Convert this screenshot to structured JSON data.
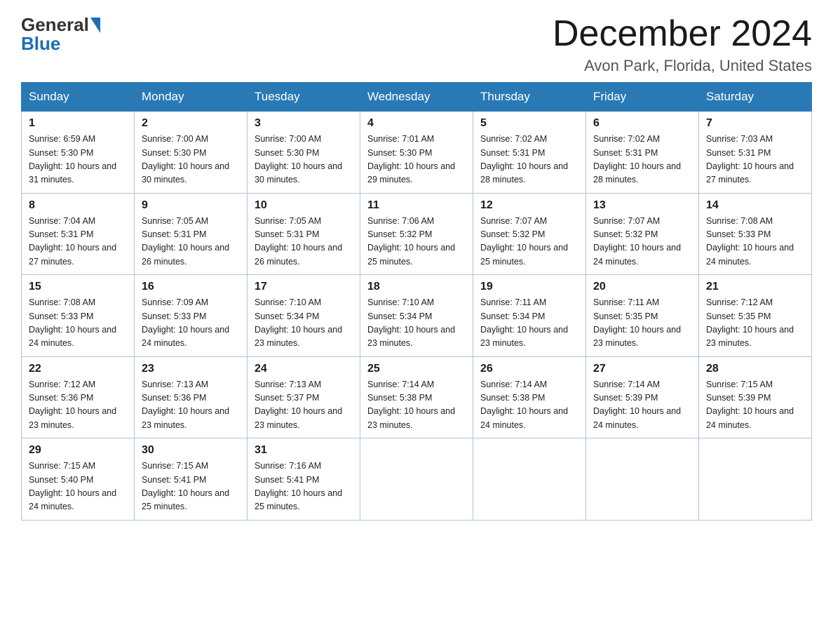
{
  "header": {
    "logo_general": "General",
    "logo_blue": "Blue",
    "month_title": "December 2024",
    "location": "Avon Park, Florida, United States"
  },
  "weekdays": [
    "Sunday",
    "Monday",
    "Tuesday",
    "Wednesday",
    "Thursday",
    "Friday",
    "Saturday"
  ],
  "weeks": [
    [
      {
        "day": "1",
        "sunrise": "6:59 AM",
        "sunset": "5:30 PM",
        "daylight": "10 hours and 31 minutes."
      },
      {
        "day": "2",
        "sunrise": "7:00 AM",
        "sunset": "5:30 PM",
        "daylight": "10 hours and 30 minutes."
      },
      {
        "day": "3",
        "sunrise": "7:00 AM",
        "sunset": "5:30 PM",
        "daylight": "10 hours and 30 minutes."
      },
      {
        "day": "4",
        "sunrise": "7:01 AM",
        "sunset": "5:30 PM",
        "daylight": "10 hours and 29 minutes."
      },
      {
        "day": "5",
        "sunrise": "7:02 AM",
        "sunset": "5:31 PM",
        "daylight": "10 hours and 28 minutes."
      },
      {
        "day": "6",
        "sunrise": "7:02 AM",
        "sunset": "5:31 PM",
        "daylight": "10 hours and 28 minutes."
      },
      {
        "day": "7",
        "sunrise": "7:03 AM",
        "sunset": "5:31 PM",
        "daylight": "10 hours and 27 minutes."
      }
    ],
    [
      {
        "day": "8",
        "sunrise": "7:04 AM",
        "sunset": "5:31 PM",
        "daylight": "10 hours and 27 minutes."
      },
      {
        "day": "9",
        "sunrise": "7:05 AM",
        "sunset": "5:31 PM",
        "daylight": "10 hours and 26 minutes."
      },
      {
        "day": "10",
        "sunrise": "7:05 AM",
        "sunset": "5:31 PM",
        "daylight": "10 hours and 26 minutes."
      },
      {
        "day": "11",
        "sunrise": "7:06 AM",
        "sunset": "5:32 PM",
        "daylight": "10 hours and 25 minutes."
      },
      {
        "day": "12",
        "sunrise": "7:07 AM",
        "sunset": "5:32 PM",
        "daylight": "10 hours and 25 minutes."
      },
      {
        "day": "13",
        "sunrise": "7:07 AM",
        "sunset": "5:32 PM",
        "daylight": "10 hours and 24 minutes."
      },
      {
        "day": "14",
        "sunrise": "7:08 AM",
        "sunset": "5:33 PM",
        "daylight": "10 hours and 24 minutes."
      }
    ],
    [
      {
        "day": "15",
        "sunrise": "7:08 AM",
        "sunset": "5:33 PM",
        "daylight": "10 hours and 24 minutes."
      },
      {
        "day": "16",
        "sunrise": "7:09 AM",
        "sunset": "5:33 PM",
        "daylight": "10 hours and 24 minutes."
      },
      {
        "day": "17",
        "sunrise": "7:10 AM",
        "sunset": "5:34 PM",
        "daylight": "10 hours and 23 minutes."
      },
      {
        "day": "18",
        "sunrise": "7:10 AM",
        "sunset": "5:34 PM",
        "daylight": "10 hours and 23 minutes."
      },
      {
        "day": "19",
        "sunrise": "7:11 AM",
        "sunset": "5:34 PM",
        "daylight": "10 hours and 23 minutes."
      },
      {
        "day": "20",
        "sunrise": "7:11 AM",
        "sunset": "5:35 PM",
        "daylight": "10 hours and 23 minutes."
      },
      {
        "day": "21",
        "sunrise": "7:12 AM",
        "sunset": "5:35 PM",
        "daylight": "10 hours and 23 minutes."
      }
    ],
    [
      {
        "day": "22",
        "sunrise": "7:12 AM",
        "sunset": "5:36 PM",
        "daylight": "10 hours and 23 minutes."
      },
      {
        "day": "23",
        "sunrise": "7:13 AM",
        "sunset": "5:36 PM",
        "daylight": "10 hours and 23 minutes."
      },
      {
        "day": "24",
        "sunrise": "7:13 AM",
        "sunset": "5:37 PM",
        "daylight": "10 hours and 23 minutes."
      },
      {
        "day": "25",
        "sunrise": "7:14 AM",
        "sunset": "5:38 PM",
        "daylight": "10 hours and 23 minutes."
      },
      {
        "day": "26",
        "sunrise": "7:14 AM",
        "sunset": "5:38 PM",
        "daylight": "10 hours and 24 minutes."
      },
      {
        "day": "27",
        "sunrise": "7:14 AM",
        "sunset": "5:39 PM",
        "daylight": "10 hours and 24 minutes."
      },
      {
        "day": "28",
        "sunrise": "7:15 AM",
        "sunset": "5:39 PM",
        "daylight": "10 hours and 24 minutes."
      }
    ],
    [
      {
        "day": "29",
        "sunrise": "7:15 AM",
        "sunset": "5:40 PM",
        "daylight": "10 hours and 24 minutes."
      },
      {
        "day": "30",
        "sunrise": "7:15 AM",
        "sunset": "5:41 PM",
        "daylight": "10 hours and 25 minutes."
      },
      {
        "day": "31",
        "sunrise": "7:16 AM",
        "sunset": "5:41 PM",
        "daylight": "10 hours and 25 minutes."
      },
      null,
      null,
      null,
      null
    ]
  ]
}
